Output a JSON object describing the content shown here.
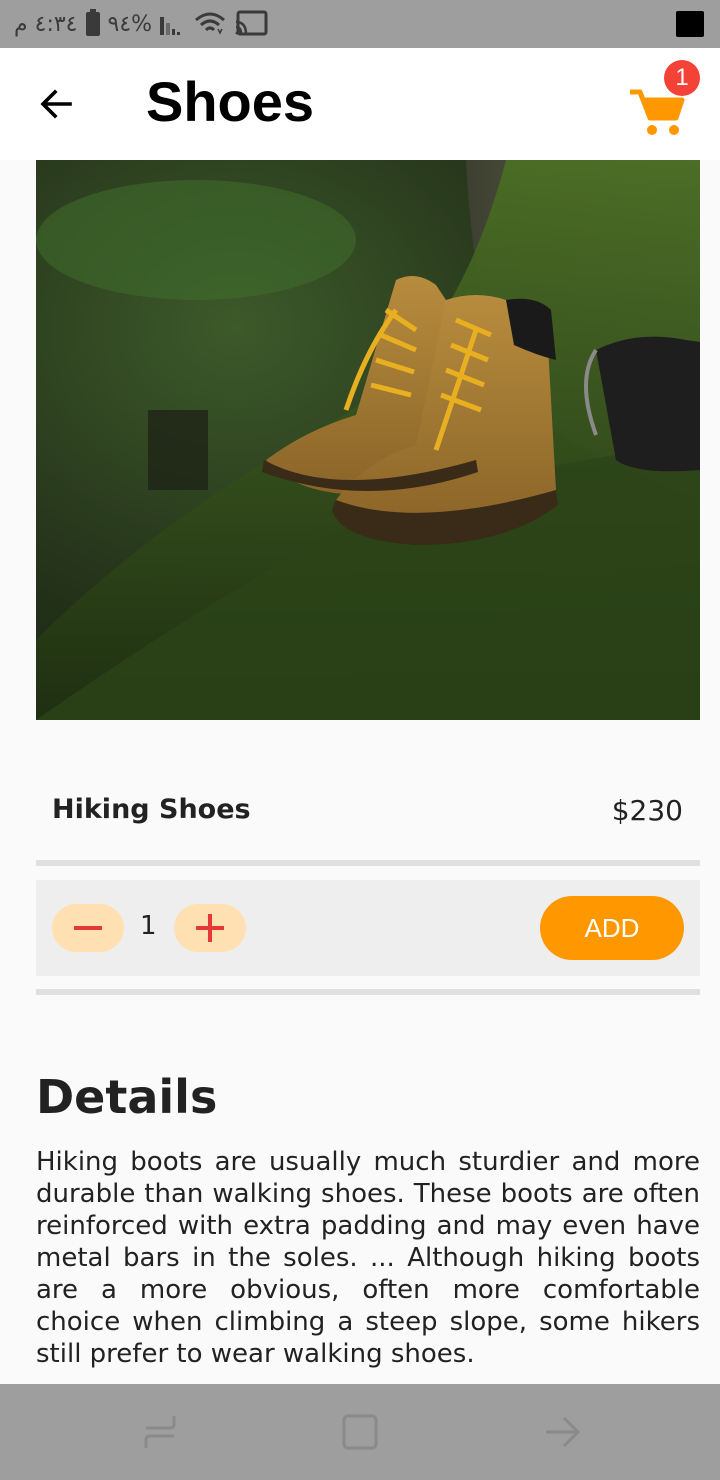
{
  "status_bar": {
    "time": "٤:٣٤ م",
    "battery": "%٩٤",
    "icons": [
      "battery-icon",
      "signal-icon",
      "wifi-icon",
      "cast-icon",
      "notification-square-icon"
    ]
  },
  "app_bar": {
    "title": "Shoes",
    "back_icon": "arrow-back-icon",
    "cart_icon": "shopping-cart-icon",
    "cart_count": "1"
  },
  "product": {
    "image": "hiking-boots-on-mossy-tree-photo",
    "name": "Hiking Shoes",
    "price": "$230"
  },
  "cart_controls": {
    "quantity": "1",
    "add_label": "ADD",
    "decrement_icon": "minus-icon",
    "increment_icon": "plus-icon"
  },
  "details": {
    "heading": "Details",
    "body": "Hiking boots are usually much sturdier and more durable than walking shoes. These boots are often reinforced with extra padding and may even have metal bars in the soles. ... Although hiking boots are a more obvious, often more comfortable choice when climbing a steep slope, some hikers still prefer to wear walking shoes."
  },
  "nav_bar": {
    "icons": [
      "recent-apps-icon",
      "home-icon",
      "back-nav-icon"
    ]
  },
  "colors": {
    "accent": "#ff9800",
    "badge": "#f44336",
    "qty_button_bg": "#ffe0b2",
    "qty_icon": "#e53935"
  }
}
